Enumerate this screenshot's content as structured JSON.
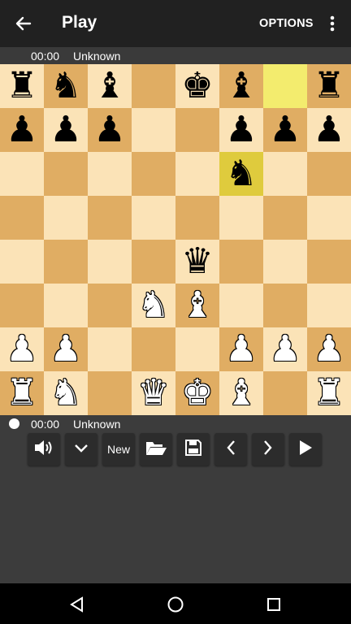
{
  "appbar": {
    "title": "Play",
    "options_label": "OPTIONS"
  },
  "top_player": {
    "time": "00:00",
    "name": "Unknown"
  },
  "bottom_player": {
    "time": "00:00",
    "name": "Unknown"
  },
  "toolbar": {
    "new_label": "New"
  },
  "board": {
    "colors": {
      "light": "#fbe3b7",
      "dark": "#e0ad63",
      "highlight_light": "#f3ec6e",
      "highlight_dark": "#dfcb3d"
    },
    "highlighted_squares": [
      "g8",
      "f6"
    ],
    "rows": [
      [
        "br",
        "bn",
        "bb",
        "",
        "bk",
        "bb",
        "",
        "br"
      ],
      [
        "bp",
        "bp",
        "bp",
        "",
        "",
        "bp",
        "bp",
        "bp"
      ],
      [
        "",
        "",
        "",
        "",
        "",
        "bn",
        "",
        ""
      ],
      [
        "",
        "",
        "",
        "",
        "",
        "",
        "",
        ""
      ],
      [
        "",
        "",
        "",
        "",
        "bq",
        "",
        "",
        ""
      ],
      [
        "",
        "",
        "",
        "wn",
        "wb",
        "",
        "",
        ""
      ],
      [
        "wp",
        "wp",
        "",
        "",
        "",
        "wp",
        "wp",
        "wp"
      ],
      [
        "wr",
        "wn",
        "",
        "wq",
        "wk",
        "wb",
        "",
        "wr"
      ]
    ]
  }
}
